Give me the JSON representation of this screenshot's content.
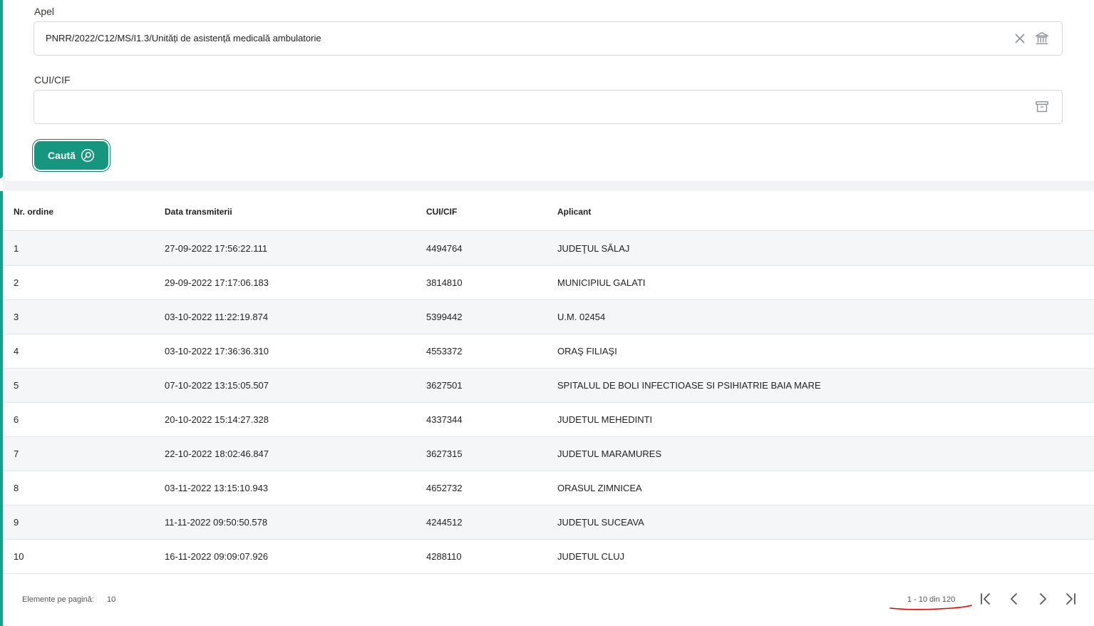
{
  "filters": {
    "apel": {
      "label": "Apel",
      "value": "PNRR/2022/C12/MS/I1.3/Unități de asistență medicală ambulatorie",
      "clear_icon": "close-icon",
      "bank_icon": "bank-icon"
    },
    "cui": {
      "label": "CUI/CIF",
      "value": "",
      "icon": "archive-icon"
    },
    "search_button": {
      "label": "Caută",
      "icon": "search-icon"
    }
  },
  "table": {
    "headers": [
      "Nr. ordine",
      "Data transmiterii",
      "CUI/CIF",
      "Aplicant"
    ],
    "rows": [
      [
        "1",
        "27-09-2022 17:56:22.111",
        "4494764",
        "JUDEŢUL SĂLAJ"
      ],
      [
        "2",
        "29-09-2022 17:17:06.183",
        "3814810",
        "MUNICIPIUL GALATI"
      ],
      [
        "3",
        "03-10-2022 11:22:19.874",
        "5399442",
        "U.M. 02454"
      ],
      [
        "4",
        "03-10-2022 17:36:36.310",
        "4553372",
        "ORAŞ FILIAŞI"
      ],
      [
        "5",
        "07-10-2022 13:15:05.507",
        "3627501",
        "SPITALUL DE BOLI INFECTIOASE SI PSIHIATRIE BAIA MARE"
      ],
      [
        "6",
        "20-10-2022 15:14:27.328",
        "4337344",
        "JUDETUL MEHEDINTI"
      ],
      [
        "7",
        "22-10-2022 18:02:46.847",
        "3627315",
        "JUDETUL MARAMURES"
      ],
      [
        "8",
        "03-11-2022 13:15:10.943",
        "4652732",
        "ORASUL ZIMNICEA"
      ],
      [
        "9",
        "11-11-2022 09:50:50.578",
        "4244512",
        "JUDEŢUL SUCEAVA"
      ],
      [
        "10",
        "16-11-2022 09:09:07.926",
        "4288110",
        "JUDETUL CLUJ"
      ]
    ]
  },
  "paginator": {
    "items_per_page_label": "Elemente pe pagină:",
    "items_per_page": "10",
    "range": "1 - 10 din 120",
    "first_icon": "first-page-icon",
    "prev_icon": "chevron-left-icon",
    "next_icon": "chevron-right-icon",
    "last_icon": "last-page-icon"
  },
  "colors": {
    "accent": "#16957f",
    "edge": "#16a08a",
    "annotation": "#e00000"
  }
}
